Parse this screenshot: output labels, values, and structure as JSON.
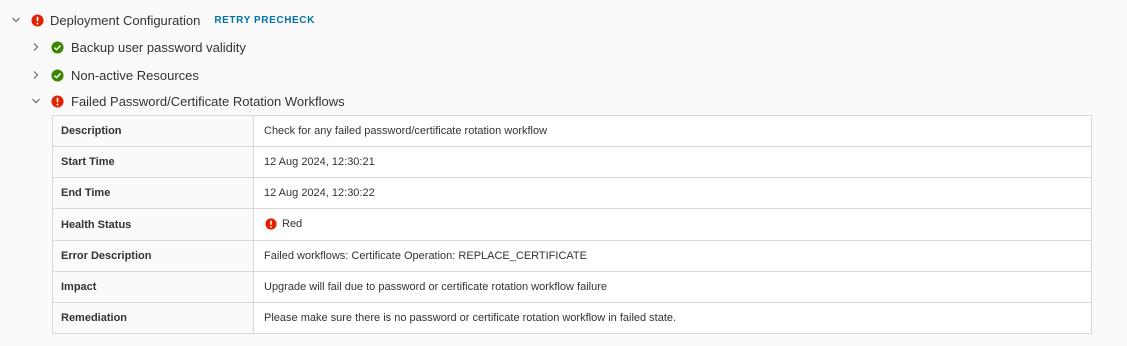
{
  "tree": {
    "root": {
      "label": "Deployment Configuration",
      "status": "error",
      "expanded": true,
      "action_label": "RETRY PRECHECK"
    },
    "children": [
      {
        "label": "Backup user password validity",
        "status": "success",
        "expanded": false
      },
      {
        "label": "Non-active Resources",
        "status": "success",
        "expanded": false
      },
      {
        "label": "Failed Password/Certificate Rotation Workflows",
        "status": "error",
        "expanded": true
      }
    ]
  },
  "details": {
    "rows": [
      {
        "key": "Description",
        "value": "Check for any failed password/certificate rotation workflow"
      },
      {
        "key": "Start Time",
        "value": "12 Aug 2024, 12:30:21"
      },
      {
        "key": "End Time",
        "value": "12 Aug 2024, 12:30:22"
      },
      {
        "key": "Health Status",
        "value": "Red",
        "icon": "error-icon"
      },
      {
        "key": "Error Description",
        "value": "Failed workflows: Certificate Operation: REPLACE_CERTIFICATE"
      },
      {
        "key": "Impact",
        "value": "Upgrade will fail due to password or certificate rotation workflow failure"
      },
      {
        "key": "Remediation",
        "value": "Please make sure there is no password or certificate rotation workflow in failed state."
      }
    ]
  },
  "colors": {
    "error": "#e12200",
    "success": "#3c8500",
    "link": "#0072a3",
    "border": "#d7d7d7"
  }
}
